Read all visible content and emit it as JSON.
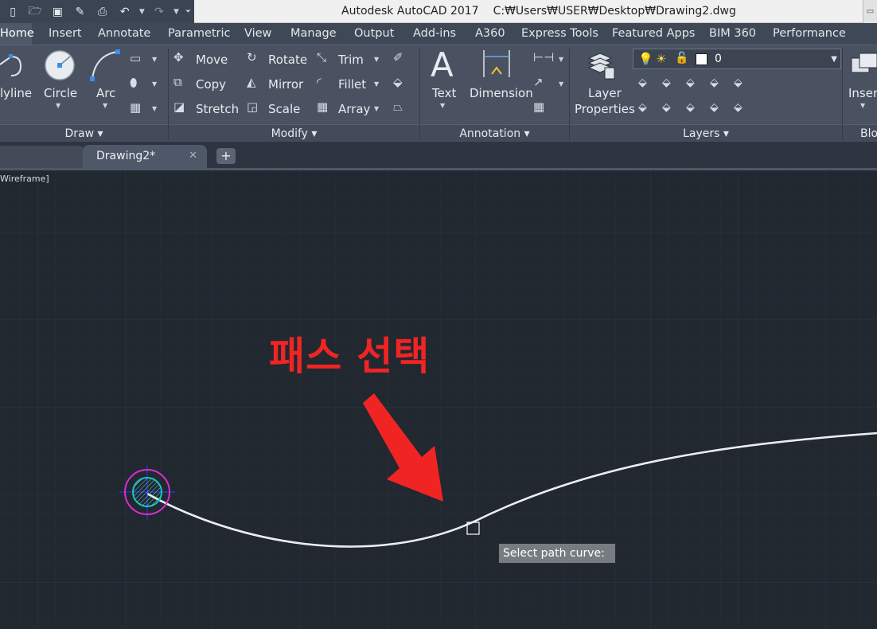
{
  "titlebar": {
    "app_title": "Autodesk AutoCAD 2017",
    "file_path": "C:₩Users₩USER₩Desktop₩Drawing2.dwg"
  },
  "ribbon_tabs": [
    "Home",
    "Insert",
    "Annotate",
    "Parametric",
    "View",
    "Manage",
    "Output",
    "Add-ins",
    "A360",
    "Express Tools",
    "Featured Apps",
    "BIM 360",
    "Performance"
  ],
  "draw_panel": {
    "polyline": "lyline",
    "circle": "Circle",
    "arc": "Arc",
    "footer": "Draw"
  },
  "modify_panel": {
    "move": "Move",
    "copy": "Copy",
    "stretch": "Stretch",
    "rotate": "Rotate",
    "mirror": "Mirror",
    "scale": "Scale",
    "trim": "Trim",
    "fillet": "Fillet",
    "array": "Array",
    "footer": "Modify"
  },
  "annotation_panel": {
    "text": "Text",
    "dimension": "Dimension",
    "footer": "Annotation"
  },
  "layers_panel": {
    "layer_properties_line1": "Layer",
    "layer_properties_line2": "Properties",
    "current_layer": "0",
    "footer": "Layers"
  },
  "block_panel": {
    "insert": "Insert",
    "footer": "Blo"
  },
  "document_tabs": {
    "active": "Drawing2*"
  },
  "viewport": {
    "visual_style": "Wireframe]"
  },
  "prompt": {
    "tooltip": "Select path curve:"
  },
  "overlay": {
    "annotation": "패스 선택",
    "annotation_color": "#f12424"
  },
  "colors": {
    "canvas_bg": "#212830",
    "ribbon_bg": "#4a5262",
    "path_curve": "#ffffff",
    "circle_outer": "#d82fd0",
    "circle_inner": "#19c3c8",
    "crosshair": "#2a3bff"
  }
}
